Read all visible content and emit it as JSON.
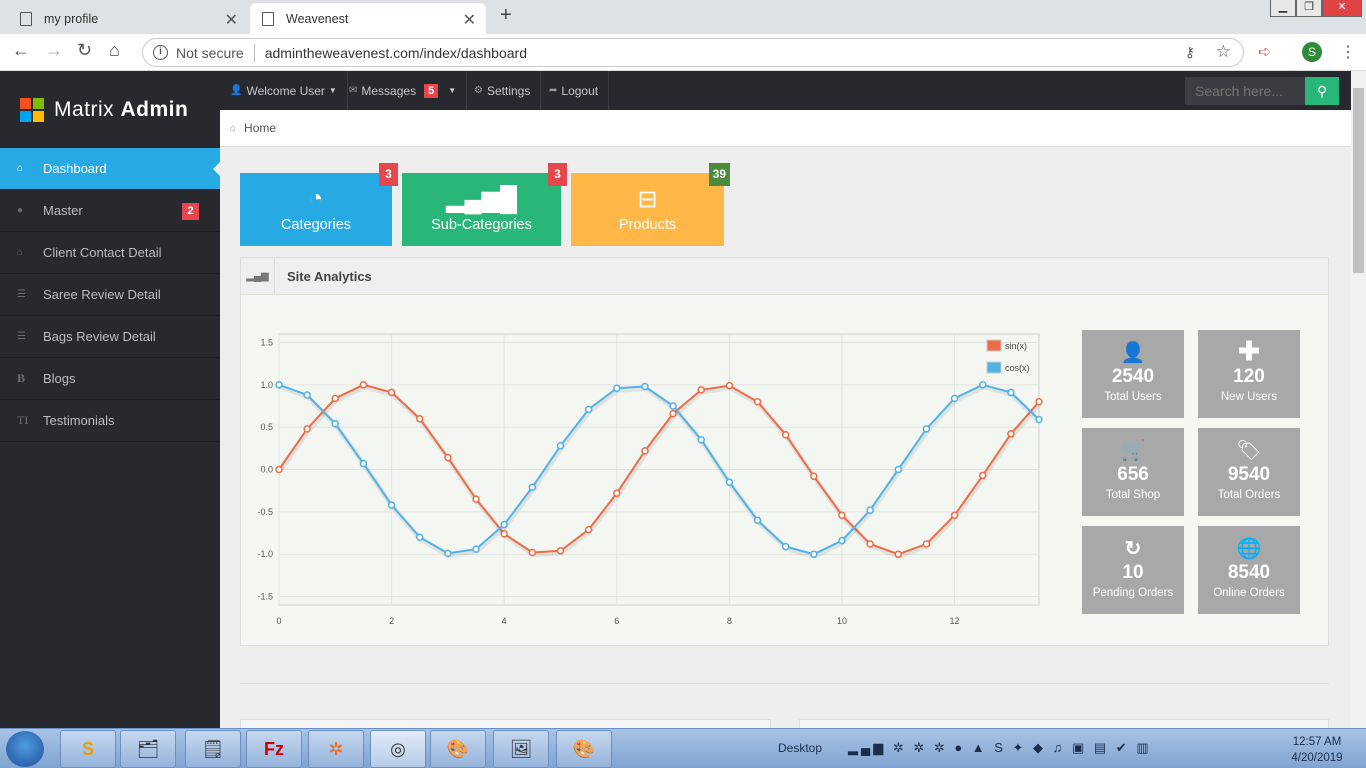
{
  "browser": {
    "tabs": [
      {
        "title": "my profile"
      },
      {
        "title": "Weavenest"
      }
    ],
    "not_secure": "Not secure",
    "url": "admintheweavenest.com/index/dashboard",
    "profile_initial": "S"
  },
  "brand": {
    "name_light": "Matrix",
    "name_bold": "Admin",
    "logo_colors": [
      "#f74e1e",
      "#7eba00",
      "#00a3ee",
      "#ffba00"
    ]
  },
  "sidebar": {
    "items": [
      {
        "label": "Dashboard",
        "icon": "home-icon",
        "active": true
      },
      {
        "label": "Master",
        "icon": "info-icon",
        "badge": "2"
      },
      {
        "label": "Client Contact Detail",
        "icon": "home-icon"
      },
      {
        "label": "Saree Review Detail",
        "icon": "list-icon"
      },
      {
        "label": "Bags Review Detail",
        "icon": "list-icon"
      },
      {
        "label": "Blogs",
        "icon": "bold-icon",
        "glyph": "B"
      },
      {
        "label": "Testimonials",
        "icon": "text-height-icon",
        "glyph": "TI"
      }
    ]
  },
  "topnav": {
    "welcome": "Welcome User",
    "messages": "Messages",
    "messages_count": "5",
    "settings": "Settings",
    "logout": "Logout",
    "search_placeholder": "Search here..."
  },
  "breadcrumb": {
    "home": "Home"
  },
  "quick_actions": [
    {
      "label": "Categories",
      "badge": "3",
      "color": "#27a9e3",
      "badge_color": "#e5484c",
      "icon": "dashboard-icon"
    },
    {
      "label": "Sub-Categories",
      "badge": "3",
      "color": "#28b779",
      "badge_color": "#e5484c",
      "icon": "signal-icon"
    },
    {
      "label": "Products",
      "badge": "39",
      "color": "#ffb848",
      "badge_color": "#4a8b3e",
      "icon": "inbox-icon"
    }
  ],
  "analytics": {
    "title": "Site Analytics",
    "stats": [
      {
        "value": "2540",
        "label": "Total Users",
        "icon": "user-icon"
      },
      {
        "value": "120",
        "label": "New Users",
        "icon": "plus-icon"
      },
      {
        "value": "656",
        "label": "Total Shop",
        "icon": "cart-icon"
      },
      {
        "value": "9540",
        "label": "Total Orders",
        "icon": "tag-icon"
      },
      {
        "value": "10",
        "label": "Pending Orders",
        "icon": "refresh-icon"
      },
      {
        "value": "8540",
        "label": "Online Orders",
        "icon": "globe-icon"
      }
    ]
  },
  "chart_data": {
    "type": "line",
    "x": [
      0,
      0.5,
      1,
      1.5,
      2,
      2.5,
      3,
      3.5,
      4,
      4.5,
      5,
      5.5,
      6,
      6.5,
      7,
      7.5,
      8,
      8.5,
      9,
      9.5,
      10,
      10.5,
      11,
      11.5,
      12,
      12.5,
      13,
      13.5
    ],
    "series": [
      {
        "name": "sin(x)",
        "color": "#ef6c44",
        "values": [
          0.0,
          0.48,
          0.84,
          1.0,
          0.91,
          0.6,
          0.14,
          -0.35,
          -0.76,
          -0.98,
          -0.96,
          -0.71,
          -0.28,
          0.22,
          0.66,
          0.94,
          0.99,
          0.8,
          0.41,
          -0.08,
          -0.54,
          -0.88,
          -1.0,
          -0.88,
          -0.54,
          -0.07,
          0.42,
          0.8
        ]
      },
      {
        "name": "cos(x)",
        "color": "#4fb3e8",
        "values": [
          1.0,
          0.88,
          0.54,
          0.07,
          -0.42,
          -0.8,
          -0.99,
          -0.94,
          -0.65,
          -0.21,
          0.28,
          0.71,
          0.96,
          0.98,
          0.75,
          0.35,
          -0.15,
          -0.6,
          -0.91,
          -1.0,
          -0.84,
          -0.48,
          0.0,
          0.48,
          0.84,
          1.0,
          0.91,
          0.59
        ]
      }
    ],
    "xticks": [
      "0",
      "2",
      "4",
      "6",
      "8",
      "10",
      "12"
    ],
    "yticks": [
      "1.5",
      "1.0",
      "0.5",
      "0.0",
      "-0.5",
      "-1.0",
      "-1.5"
    ],
    "xlim": [
      0,
      13.5
    ],
    "ylim": [
      -1.6,
      1.6
    ],
    "grid": true,
    "legend": "top-right"
  },
  "taskbar": {
    "desktop": "Desktop",
    "time": "12:57 AM",
    "date": "4/20/2019"
  }
}
